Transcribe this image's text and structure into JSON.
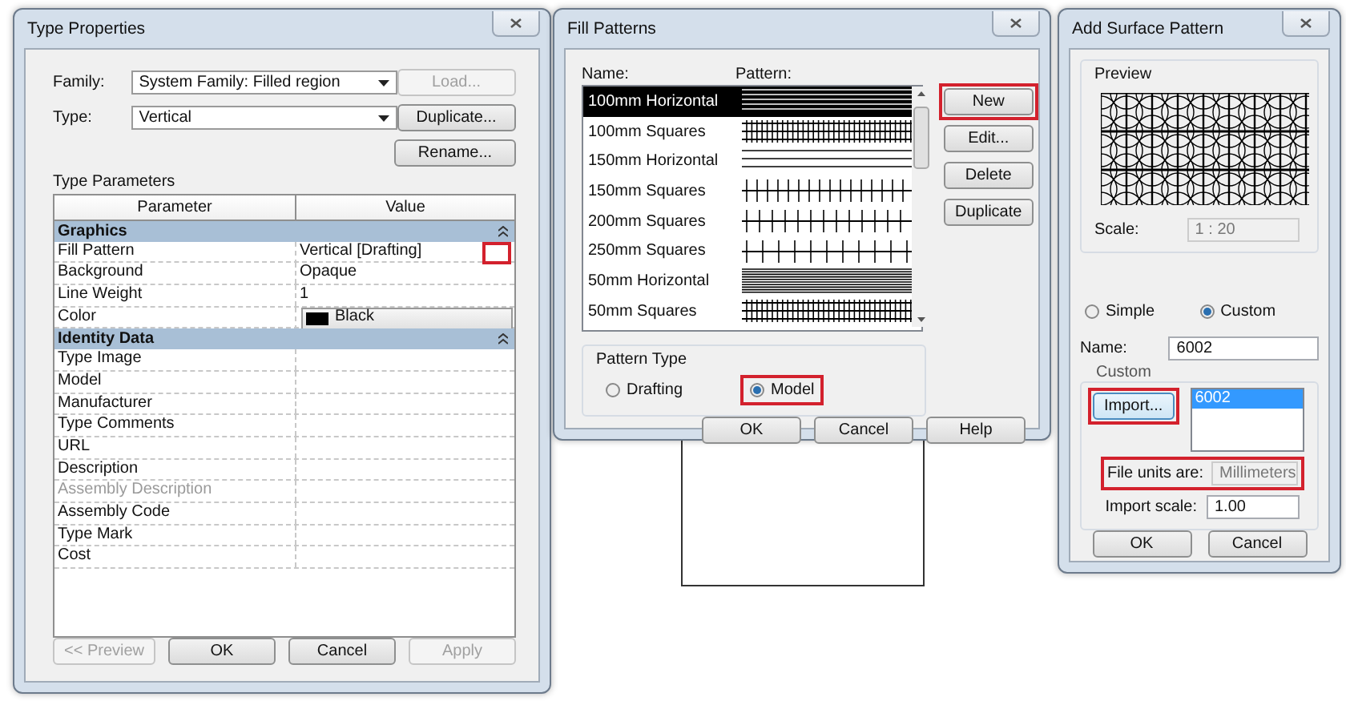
{
  "type_properties": {
    "title": "Type Properties",
    "family": {
      "label": "Family:",
      "value": "System Family: Filled region"
    },
    "type": {
      "label": "Type:",
      "value": "Vertical"
    },
    "side_buttons": [
      {
        "label": "Load...",
        "disabled": true
      },
      {
        "label": "Duplicate...",
        "disabled": false
      },
      {
        "label": "Rename...",
        "disabled": false
      }
    ],
    "section": "Type Parameters",
    "columns": [
      "Parameter",
      "Value"
    ],
    "groups": [
      {
        "title": "Graphics",
        "expanded": true,
        "rows": [
          {
            "parameter": "Fill Pattern",
            "value": "Vertical [Drafting]",
            "kind": "pattern",
            "highlighted": true,
            "disabled": false
          },
          {
            "parameter": "Background",
            "value": "Opaque",
            "kind": "text",
            "disabled": false
          },
          {
            "parameter": "Line Weight",
            "value": "1",
            "kind": "text",
            "disabled": false
          },
          {
            "parameter": "Color",
            "value": "Black",
            "kind": "color",
            "color": "#000000",
            "disabled": false
          }
        ]
      },
      {
        "title": "Identity Data",
        "expanded": true,
        "rows": [
          {
            "parameter": "Type Image",
            "kind": "text",
            "disabled": false
          },
          {
            "parameter": "Model",
            "kind": "text",
            "disabled": false
          },
          {
            "parameter": "Manufacturer",
            "kind": "text",
            "disabled": false
          },
          {
            "parameter": "Type Comments",
            "kind": "text",
            "disabled": false
          },
          {
            "parameter": "URL",
            "kind": "text",
            "disabled": false
          },
          {
            "parameter": "Description",
            "kind": "text",
            "disabled": false
          },
          {
            "parameter": "Assembly Description",
            "kind": "text",
            "disabled": true
          },
          {
            "parameter": "Assembly Code",
            "kind": "text",
            "disabled": false
          },
          {
            "parameter": "Type Mark",
            "kind": "text",
            "disabled": false
          },
          {
            "parameter": "Cost",
            "kind": "text",
            "disabled": false
          }
        ]
      }
    ],
    "buttons": [
      {
        "label": "<< Preview",
        "disabled": true
      },
      {
        "label": "OK",
        "disabled": false
      },
      {
        "label": "Cancel",
        "disabled": false
      },
      {
        "label": "Apply",
        "disabled": true
      }
    ]
  },
  "fill_patterns": {
    "title": "Fill Patterns",
    "columns": [
      "Name:",
      "Pattern:"
    ],
    "patterns": [
      {
        "name": "100mm Horizontal",
        "kind": "horizontal",
        "selected": true
      },
      {
        "name": "100mm Squares",
        "kind": "squares",
        "selected": false
      },
      {
        "name": "150mm Horizontal",
        "kind": "horizontal",
        "selected": false
      },
      {
        "name": "150mm Squares",
        "kind": "squares",
        "selected": false
      },
      {
        "name": "200mm Squares",
        "kind": "squares",
        "selected": false
      },
      {
        "name": "250mm Squares",
        "kind": "squares",
        "selected": false
      },
      {
        "name": "50mm Horizontal",
        "kind": "horizontal",
        "selected": false
      },
      {
        "name": "50mm Squares",
        "kind": "squares",
        "selected": false
      }
    ],
    "side_buttons": [
      {
        "label": "New",
        "highlighted": true
      },
      {
        "label": "Edit...",
        "highlighted": false
      },
      {
        "label": "Delete",
        "highlighted": false
      },
      {
        "label": "Duplicate",
        "highlighted": false
      }
    ],
    "pattern_type": {
      "label": "Pattern Type",
      "options": [
        {
          "label": "Drafting",
          "selected": false,
          "highlighted": false
        },
        {
          "label": "Model",
          "selected": true,
          "highlighted": true
        }
      ]
    },
    "buttons": [
      "OK",
      "Cancel",
      "Help"
    ]
  },
  "add_surface_pattern": {
    "title": "Add Surface Pattern",
    "preview": {
      "label": "Preview",
      "scale_label": "Scale:",
      "scale": "1 : 20"
    },
    "modes": [
      {
        "label": "Simple",
        "selected": false
      },
      {
        "label": "Custom",
        "selected": true
      }
    ],
    "name": {
      "label": "Name:",
      "value": "6002"
    },
    "custom": {
      "label": "Custom",
      "import_button": {
        "label": "Import...",
        "highlighted": true
      },
      "files": [
        {
          "name": "6002",
          "selected": true
        }
      ],
      "file_units": {
        "label": "File units are:",
        "value": "Millimeters",
        "highlighted": true
      },
      "import_scale": {
        "label": "Import scale:",
        "value": "1.00"
      }
    },
    "buttons": [
      "OK",
      "Cancel"
    ]
  }
}
